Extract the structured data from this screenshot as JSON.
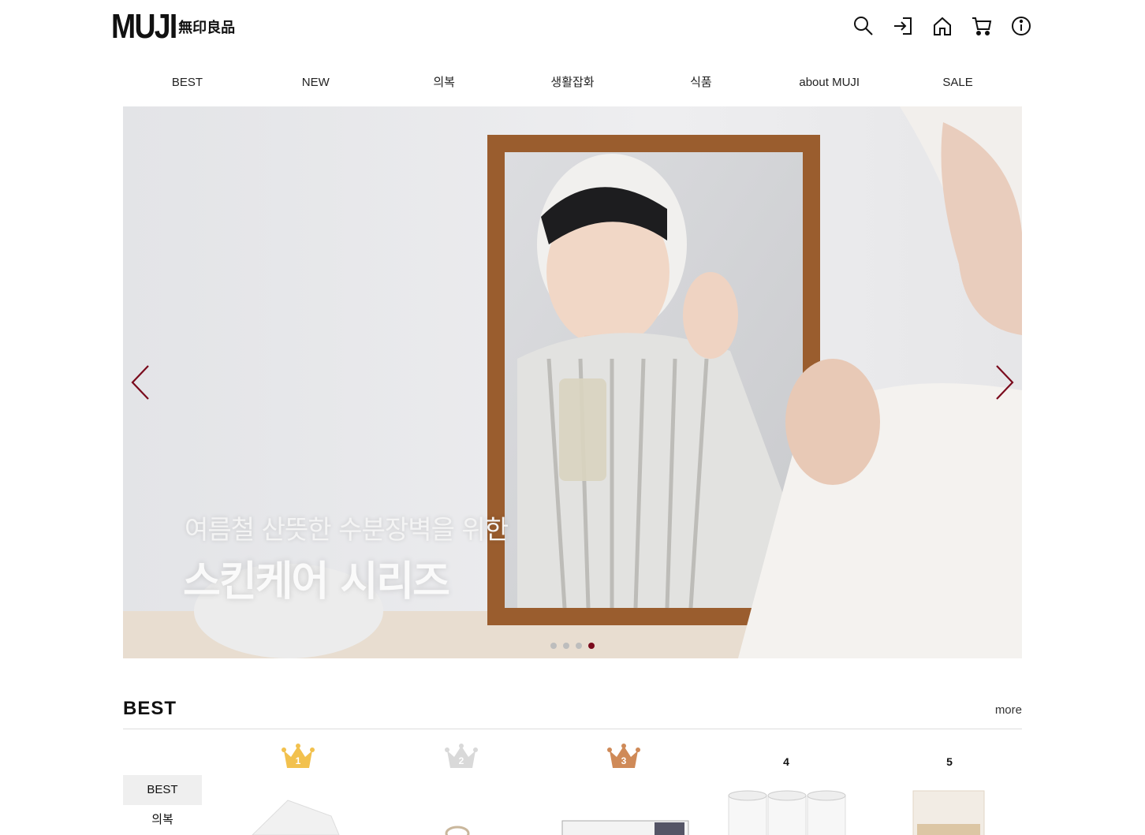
{
  "header": {
    "logo_main": "MUJI",
    "logo_sub": "無印良品",
    "icons": [
      "search-icon",
      "login-icon",
      "home-icon",
      "cart-icon",
      "info-icon"
    ]
  },
  "nav": {
    "items": [
      "BEST",
      "NEW",
      "의복",
      "생활잡화",
      "식품",
      "about MUJI",
      "SALE"
    ]
  },
  "hero": {
    "subtitle": "여름철 산뜻한 수분장벽을 위한",
    "title": "스킨케어 시리즈",
    "slide_count": 4,
    "active_slide": 4,
    "accent_color": "#7a0a1c"
  },
  "best": {
    "title": "BEST",
    "more_label": "more",
    "tabs": [
      "BEST",
      "의복"
    ],
    "active_tab": "BEST",
    "ranks": [
      {
        "num": "1",
        "crown_color": "#f2c14e"
      },
      {
        "num": "2",
        "crown_color": "#d9d9d9"
      },
      {
        "num": "3",
        "crown_color": "#cf8a58"
      },
      {
        "num": "4"
      },
      {
        "num": "5"
      }
    ]
  }
}
